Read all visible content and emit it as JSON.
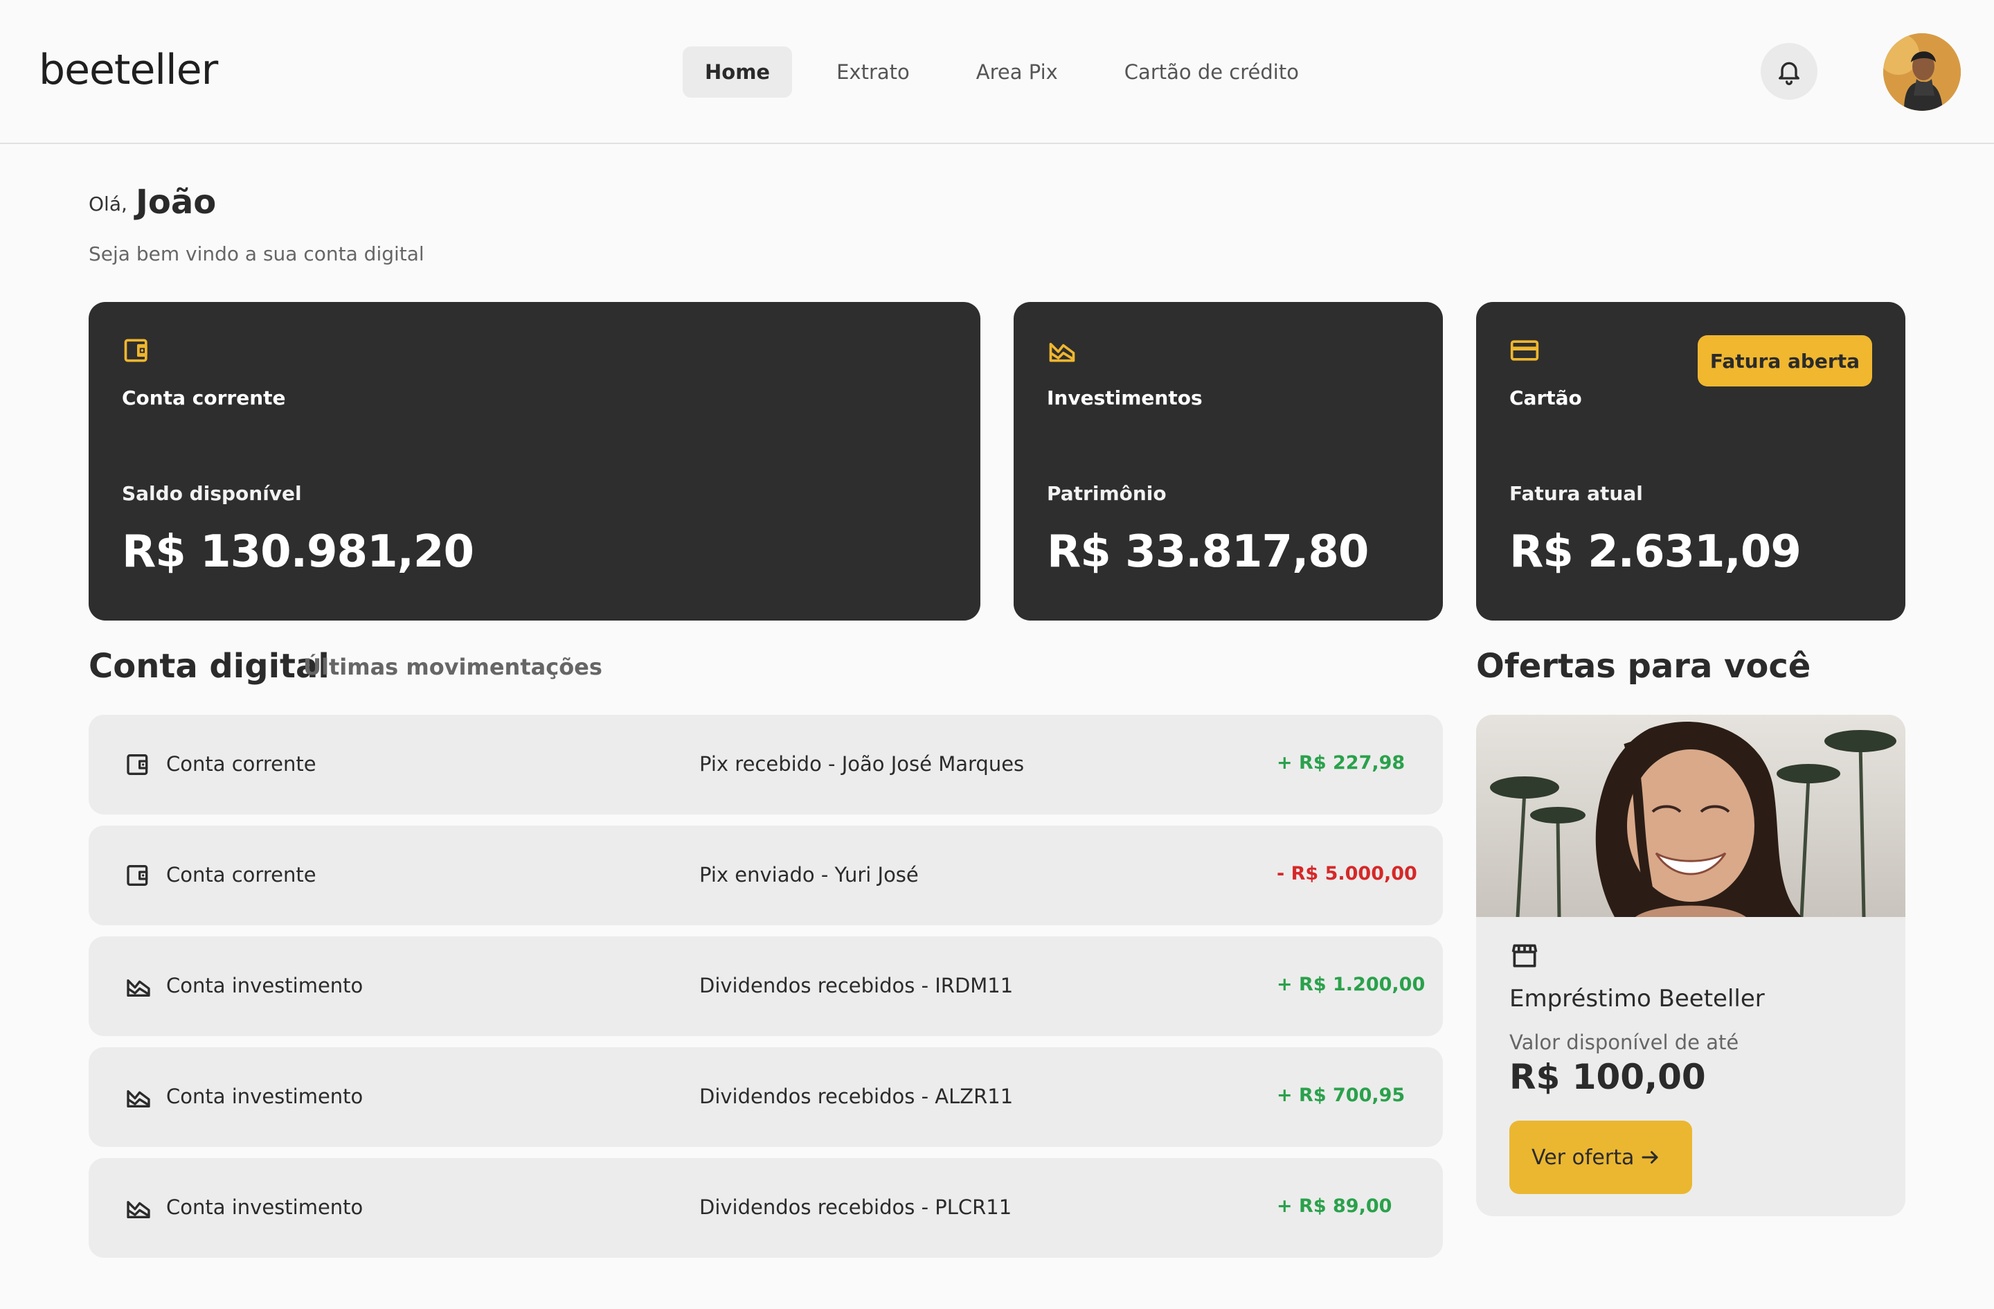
{
  "brand": {
    "logo_text": "beeteller"
  },
  "nav": {
    "items": [
      {
        "label": "Home",
        "active": true
      },
      {
        "label": "Extrato",
        "active": false
      },
      {
        "label": "Area Pix",
        "active": false
      },
      {
        "label": "Cartão de crédito",
        "active": false
      }
    ]
  },
  "header": {
    "bell_icon": "bell-icon",
    "avatar_icon": "user-avatar"
  },
  "greeting": {
    "hi": "Olá,",
    "name": "João",
    "subtitle": "Seja bem vindo a sua conta digital"
  },
  "cards": {
    "checking": {
      "icon": "wallet-icon",
      "title": "Conta corrente",
      "label": "Saldo disponível",
      "value": "R$ 130.981,20"
    },
    "investments": {
      "icon": "chart-area-icon",
      "title": "Investimentos",
      "label": "Patrimônio",
      "value": "R$ 33.817,80"
    },
    "card": {
      "icon": "credit-card-icon",
      "title": "Cartão",
      "badge": "Fatura aberta",
      "label": "Fatura atual",
      "value": "R$ 2.631,09"
    }
  },
  "accent_color": "#F0B72F",
  "dark_card_color": "#2E2E2E",
  "transactions": {
    "title": "Conta digital",
    "subtitle": "Últimas movimentações",
    "items": [
      {
        "icon": "wallet-icon",
        "account": "Conta corrente",
        "description": "Pix recebido - João José Marques",
        "amount": "+ R$ 227,98",
        "type": "credit"
      },
      {
        "icon": "wallet-icon",
        "account": "Conta corrente",
        "description": "Pix enviado - Yuri José",
        "amount": "- R$ 5.000,00",
        "type": "debit"
      },
      {
        "icon": "chart-area-icon",
        "account": "Conta investimento",
        "description": "Dividendos recebidos - IRDM11",
        "amount": "+ R$ 1.200,00",
        "type": "credit"
      },
      {
        "icon": "chart-area-icon",
        "account": "Conta investimento",
        "description": "Dividendos recebidos - ALZR11",
        "amount": "+ R$ 700,95",
        "type": "credit"
      },
      {
        "icon": "chart-area-icon",
        "account": "Conta investimento",
        "description": "Dividendos recebidos - PLCR11",
        "amount": "+ R$ 89,00",
        "type": "credit"
      }
    ]
  },
  "offers": {
    "title": "Ofertas para você",
    "item": {
      "icon": "store-icon",
      "title": "Empréstimo Beeteller",
      "label": "Valor disponível de até",
      "value": "R$ 100,00",
      "button": "Ver oferta"
    }
  }
}
